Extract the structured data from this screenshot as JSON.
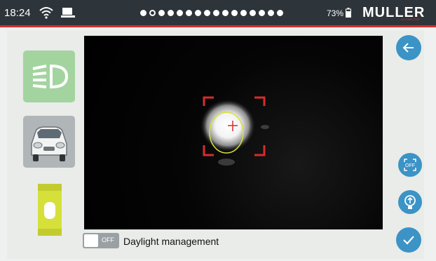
{
  "status": {
    "time": "18:24",
    "battery": "73%",
    "page_count": 16,
    "active_page": 1
  },
  "brand": {
    "logo": "MULLER",
    "tagline": "AUTOMOTIVE"
  },
  "sidebar": {
    "headlight_icon": "headlight-icon",
    "car_icon": "car-front-icon",
    "level_icon": "spirit-level-icon"
  },
  "controls": {
    "back_icon": "arrow-left-icon",
    "fullscreen_off_label": "OFF",
    "bulb_icon": "bulb-icon",
    "confirm_icon": "check-icon"
  },
  "daylight": {
    "toggle_state": "OFF",
    "label": "Daylight management"
  },
  "colors": {
    "accent_blue": "#3b93c6",
    "brand_red": "#d92b2b",
    "headlight_green": "#a3d49f",
    "level_yellow": "#d6e03a"
  }
}
